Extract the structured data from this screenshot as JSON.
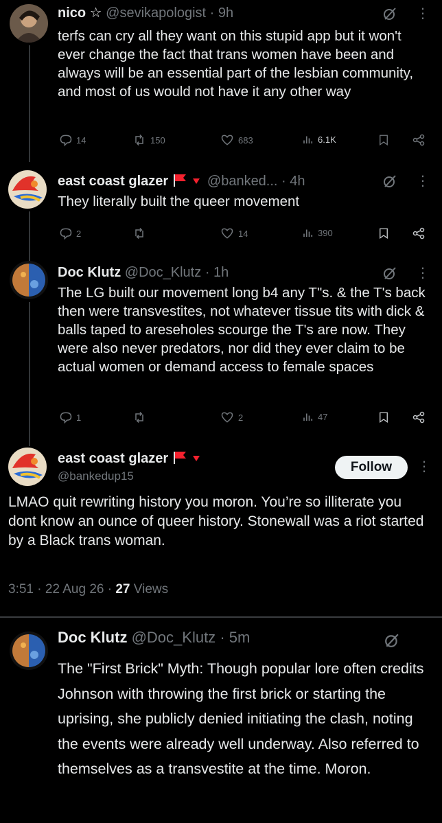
{
  "tweets": [
    {
      "name": "nico ☆",
      "handle": "@sevikapologist",
      "time": "9h",
      "text": "terfs can cry all they want on this stupid app but it won't ever change the fact that trans women have been and always will be an essential part of the lesbian community, and most of us would not have it any other way",
      "replies": "14",
      "reposts": "150",
      "likes": "683",
      "views": "6.1K"
    },
    {
      "name": "east coast glazer",
      "handle": "@banked...",
      "time": "4h",
      "text": "They literally built the queer movement",
      "replies": "2",
      "reposts": "",
      "likes": "14",
      "views": "390"
    },
    {
      "name": "Doc Klutz",
      "handle": "@Doc_Klutz",
      "time": "1h",
      "text": "The LG built our movement long b4 any T\"s. & the T's back then were transvestites, not whatever tissue tits with dick & balls taped to areseholes scourge the T's are now. They were also never predators, nor did they ever claim to be actual women or demand access to female spaces",
      "replies": "1",
      "reposts": "",
      "likes": "2",
      "views": "47"
    }
  ],
  "focus": {
    "name": "east coast glazer",
    "handle": "@bankedup15",
    "follow_label": "Follow",
    "text": "LMAO quit rewriting history you moron. You’re so illiterate you dont know an ounce of queer history. Stonewall was a riot started by a Black trans woman.",
    "time": "3:51",
    "date": "22 Aug 26",
    "views_count": "27",
    "views_label": "Views"
  },
  "reply": {
    "name": "Doc Klutz",
    "handle": "@Doc_Klutz",
    "time": "5m",
    "text": "The \"First Brick\" Myth: Though popular lore often credits Johnson with throwing the first brick or starting the uprising, she publicly denied initiating the clash, noting the events were already well underway. Also referred to themselves as a transvestite at the time. Moron."
  },
  "icons": [
    "reply-icon",
    "repost-icon",
    "like-icon",
    "views-icon",
    "bookmark-icon",
    "share-icon",
    "grok-icon",
    "more-icon",
    "flag-icon",
    "chevron-down-icon"
  ],
  "colors": {
    "background": "#000000",
    "text": "#e7e9ea",
    "muted": "#71767b",
    "flag": "#f4212e"
  }
}
